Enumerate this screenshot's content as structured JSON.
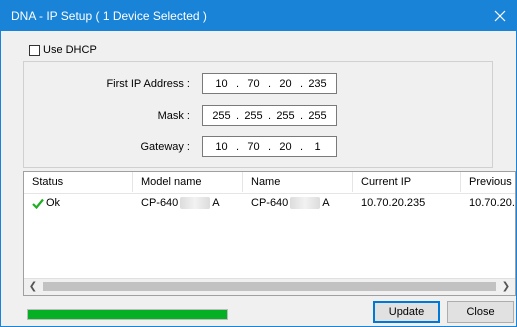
{
  "window": {
    "title": "DNA - IP Setup ( 1 Device Selected )"
  },
  "use_dhcp": {
    "label": "Use DHCP",
    "checked": false
  },
  "fields": {
    "first_ip": {
      "label": "First IP Address :",
      "octets": [
        "10",
        "70",
        "20",
        "235"
      ]
    },
    "mask": {
      "label": "Mask :",
      "octets": [
        "255",
        "255",
        "255",
        "255"
      ]
    },
    "gateway": {
      "label": "Gateway :",
      "octets": [
        "10",
        "70",
        "20",
        "1"
      ]
    }
  },
  "list": {
    "columns": [
      "Status",
      "Model name",
      "Name",
      "Current IP",
      "Previous IP"
    ],
    "rows": [
      {
        "status": "Ok",
        "model_prefix": "CP-640",
        "model_suffix": "A",
        "name_prefix": "CP-640",
        "name_suffix": "A",
        "current_ip": "10.70.20.235",
        "previous_ip": "10.70.20."
      }
    ]
  },
  "progress": {
    "fraction": 1.0,
    "color": "#06b025"
  },
  "buttons": {
    "update": "Update",
    "close": "Close"
  },
  "colors": {
    "titlebar": "#1883d7",
    "ok_check": "#1fae24"
  },
  "icons": {
    "close": "close-icon",
    "ok": "check-icon",
    "scroll_left": "chevron-left-icon",
    "scroll_right": "chevron-right-icon"
  }
}
